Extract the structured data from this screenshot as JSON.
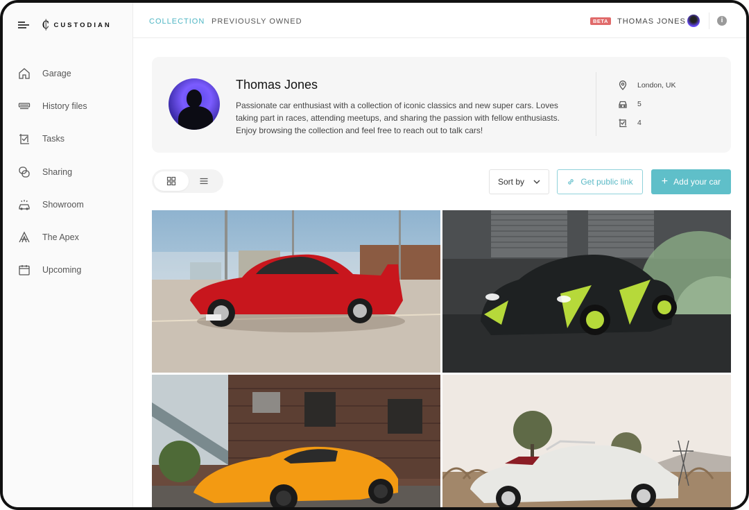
{
  "brand": {
    "mark": "₵",
    "name": "CUSTODIAN"
  },
  "sidebar": {
    "items": [
      {
        "label": "Garage",
        "icon": "home-icon"
      },
      {
        "label": "History files",
        "icon": "history-files-icon"
      },
      {
        "label": "Tasks",
        "icon": "tasks-icon"
      },
      {
        "label": "Sharing",
        "icon": "sharing-icon"
      },
      {
        "label": "Showroom",
        "icon": "showroom-icon"
      },
      {
        "label": "The Apex",
        "icon": "apex-icon"
      },
      {
        "label": "Upcoming",
        "icon": "calendar-icon"
      }
    ]
  },
  "header": {
    "tabs": [
      {
        "label": "COLLECTION",
        "active": true
      },
      {
        "label": "PREVIOUSLY OWNED",
        "active": false
      }
    ],
    "beta_badge": "BETA",
    "user_name": "THOMAS JONES",
    "info_glyph": "i"
  },
  "profile": {
    "name": "Thomas Jones",
    "bio": "Passionate car enthusiast with a collection of iconic classics and new super cars. Loves taking part in races, attending meetups, and sharing the passion with fellow enthusiasts. Enjoy browsing the collection and feel free to reach out to talk cars!",
    "location": "London, UK",
    "cars_count": "5",
    "tasks_count": "4"
  },
  "toolbar": {
    "sort_label": "Sort by",
    "public_link_label": "Get public link",
    "add_car_label": "Add your car",
    "add_car_glyph": "+"
  },
  "gallery": {
    "cars": [
      {
        "name": "red-porsche-photo",
        "color": "#c8161d"
      },
      {
        "name": "green-gtr-photo",
        "color": "#b6d93a"
      },
      {
        "name": "orange-mclaren-photo",
        "color": "#f39a12"
      },
      {
        "name": "white-speedster-photo",
        "color": "#e8e8e4"
      }
    ]
  },
  "colors": {
    "accent": "#4fb6c4",
    "button_fill": "#5fbfc9",
    "beta": "#e06a6a"
  }
}
